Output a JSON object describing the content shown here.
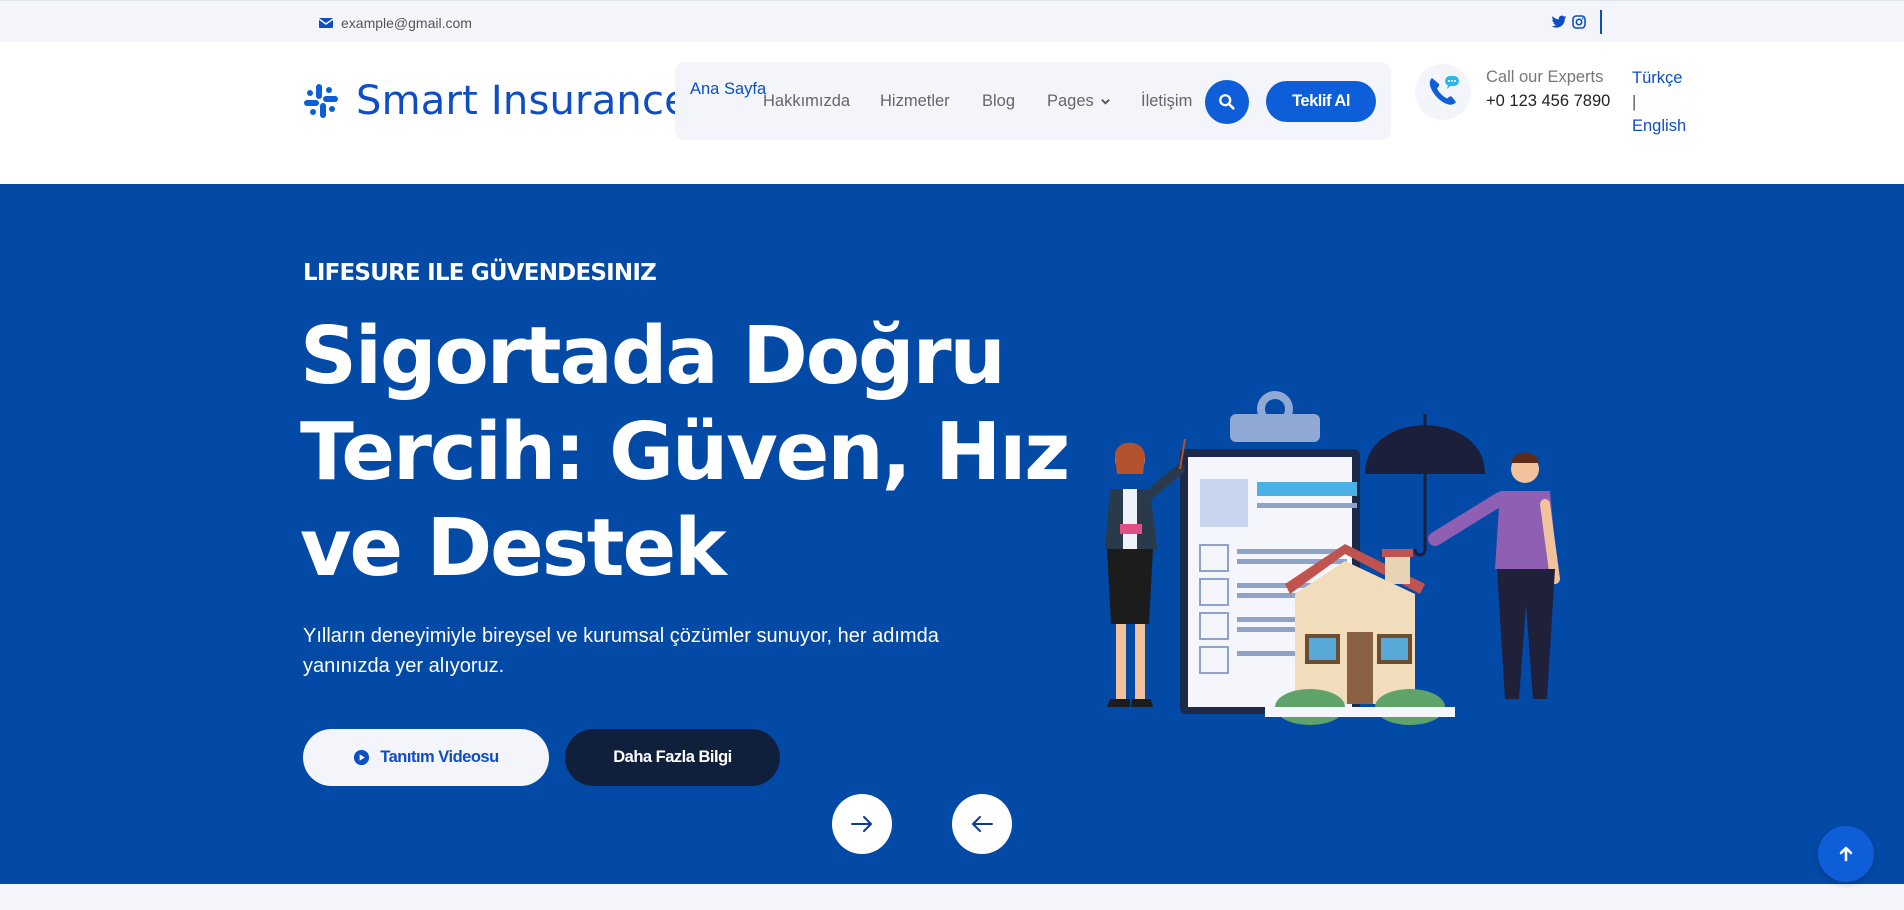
{
  "topbar": {
    "email": "example@gmail.com",
    "social_icons": [
      "twitter-icon",
      "instagram-icon"
    ]
  },
  "header": {
    "brand": "Smart Insurance",
    "nav": {
      "home": "Ana Sayfa",
      "about": "Hakkımızda",
      "services": "Hizmetler",
      "blog": "Blog",
      "pages": "Pages",
      "contact": "İletişim",
      "quote_button": "Teklif Al"
    },
    "call": {
      "label": "Call our Experts",
      "number": "+0 123 456 7890"
    },
    "languages": {
      "turkish": "Türkçe",
      "separator": "|",
      "english": "English"
    }
  },
  "hero": {
    "eyebrow": "LIFESURE ILE GÜVENDESINIZ",
    "title_lines": [
      "Sigortada Doğru",
      "Tercih: Güven, Hız",
      "ve Destek"
    ],
    "description": "Yılların deneyimiyle bireysel ve kurumsal çözümler sunuyor, her adımda yanınızda yer alıyoruz.",
    "video_button": "Tanıtım Videosu",
    "more_button": "Daha Fazla Bilgi"
  },
  "colors": {
    "primary": "#0d5ed8",
    "hero_bg": "#034aa6",
    "dark_button": "#101f3c",
    "light_bg": "#f3f5fa"
  }
}
